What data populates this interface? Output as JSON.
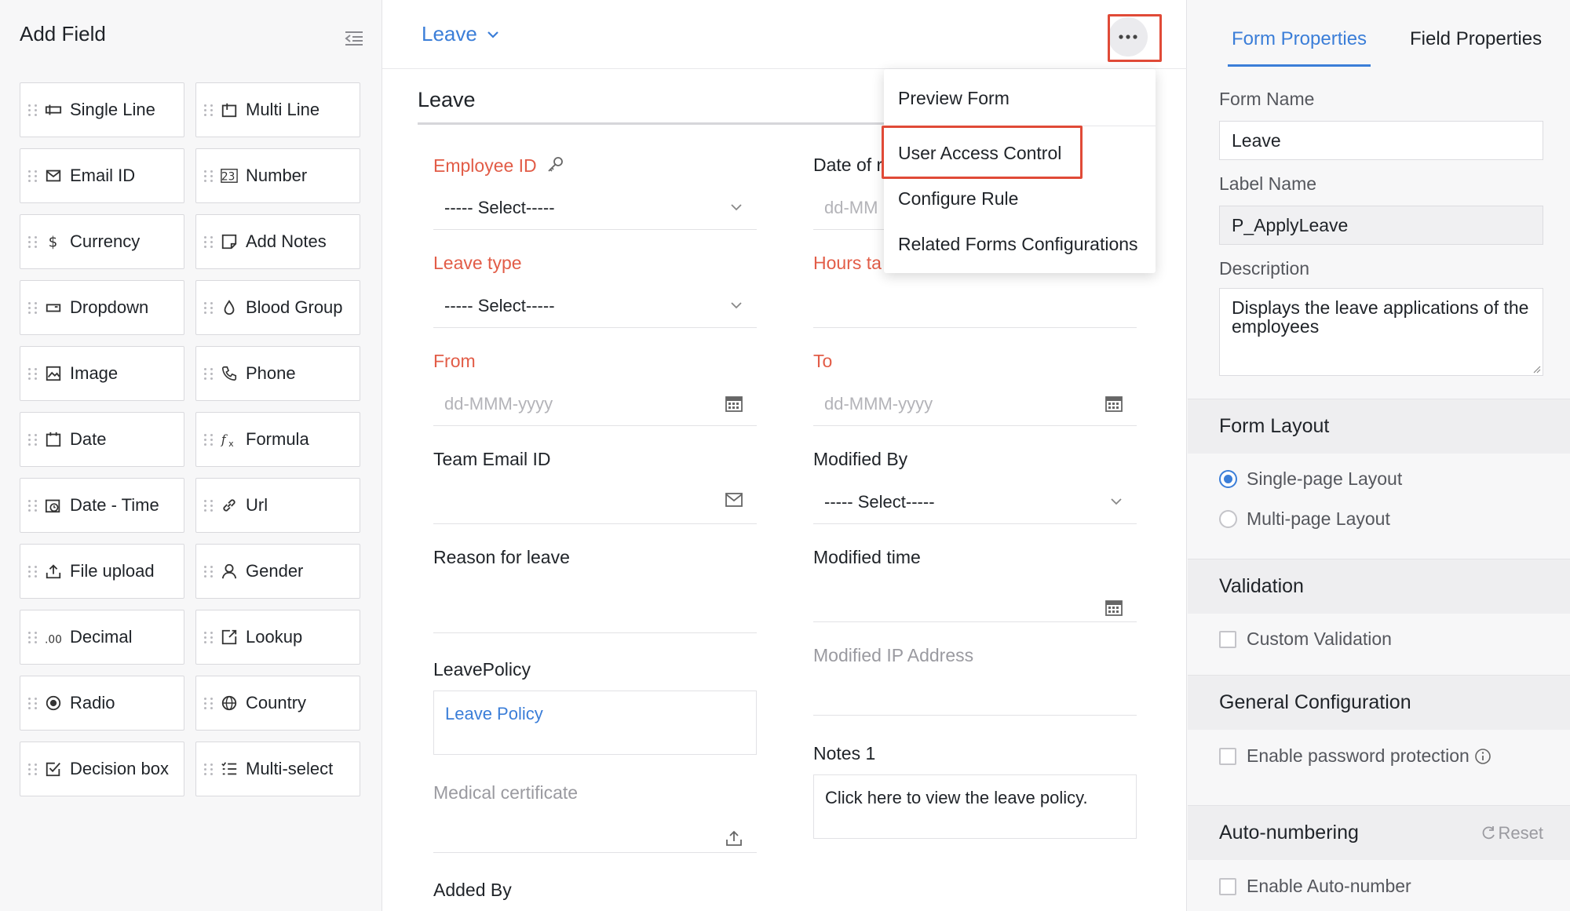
{
  "left_panel": {
    "title": "Add Field",
    "fields": [
      {
        "label": "Single Line",
        "icon": "single-line-icon"
      },
      {
        "label": "Multi Line",
        "icon": "multi-line-icon"
      },
      {
        "label": "Email ID",
        "icon": "email-icon"
      },
      {
        "label": "Number",
        "icon": "number-icon"
      },
      {
        "label": "Currency",
        "icon": "currency-icon"
      },
      {
        "label": "Add Notes",
        "icon": "notes-icon"
      },
      {
        "label": "Dropdown",
        "icon": "dropdown-icon"
      },
      {
        "label": "Blood Group",
        "icon": "blood-drop-icon"
      },
      {
        "label": "Image",
        "icon": "image-icon"
      },
      {
        "label": "Phone",
        "icon": "phone-icon"
      },
      {
        "label": "Date",
        "icon": "date-icon"
      },
      {
        "label": "Formula",
        "icon": "formula-icon"
      },
      {
        "label": "Date - Time",
        "icon": "date-time-icon"
      },
      {
        "label": "Url",
        "icon": "link-icon"
      },
      {
        "label": "File upload",
        "icon": "upload-icon"
      },
      {
        "label": "Gender",
        "icon": "person-icon"
      },
      {
        "label": "Decimal",
        "icon": "decimal-icon"
      },
      {
        "label": "Lookup",
        "icon": "lookup-icon"
      },
      {
        "label": "Radio",
        "icon": "radio-icon"
      },
      {
        "label": "Country",
        "icon": "globe-icon"
      },
      {
        "label": "Decision box",
        "icon": "checkbox-icon"
      },
      {
        "label": "Multi-select",
        "icon": "multi-select-icon"
      }
    ]
  },
  "center": {
    "form_selector": "Leave",
    "form_heading": "Leave",
    "fields": {
      "employee_id": {
        "label": "Employee ID",
        "value": "----- Select-----"
      },
      "date_of": {
        "label": "Date of r",
        "placeholder": "dd-MM"
      },
      "leave_type": {
        "label": "Leave type",
        "value": "----- Select-----"
      },
      "hours_taken": {
        "label": "Hours ta"
      },
      "from": {
        "label": "From",
        "placeholder": "dd-MMM-yyyy"
      },
      "to": {
        "label": "To",
        "placeholder": "dd-MMM-yyyy"
      },
      "team_email": {
        "label": "Team Email ID"
      },
      "modified_by": {
        "label": "Modified By",
        "value": "----- Select-----"
      },
      "reason": {
        "label": "Reason for leave"
      },
      "modified_time": {
        "label": "Modified time"
      },
      "leave_policy": {
        "label": "LeavePolicy",
        "link": "Leave Policy"
      },
      "modified_ip": {
        "label": "Modified IP Address"
      },
      "notes1": {
        "label": "Notes 1",
        "value": "Click here to view the leave policy."
      },
      "medical": {
        "label": "Medical certificate"
      },
      "added_by": {
        "label": "Added By"
      }
    },
    "menu": {
      "items": [
        "Preview Form",
        "User Access Control",
        "Configure Rule",
        "Related Forms Configurations"
      ]
    }
  },
  "right_panel": {
    "tabs": [
      "Form Properties",
      "Field Properties"
    ],
    "form_name_label": "Form Name",
    "form_name_value": "Leave",
    "label_name_label": "Label Name",
    "label_name_value": "P_ApplyLeave",
    "description_label": "Description",
    "description_value": "Displays the leave applications of the employees",
    "form_layout": {
      "title": "Form Layout",
      "options": [
        "Single-page Layout",
        "Multi-page Layout"
      ],
      "selected": "Single-page Layout"
    },
    "validation": {
      "title": "Validation",
      "option": "Custom Validation"
    },
    "general": {
      "title": "General Configuration",
      "option": "Enable password protection"
    },
    "autonum": {
      "title": "Auto-numbering",
      "reset": "Reset",
      "option": "Enable Auto-number"
    }
  },
  "colors": {
    "accent": "#3b7ed8",
    "required": "#e25c47",
    "highlight": "#e04a37"
  }
}
